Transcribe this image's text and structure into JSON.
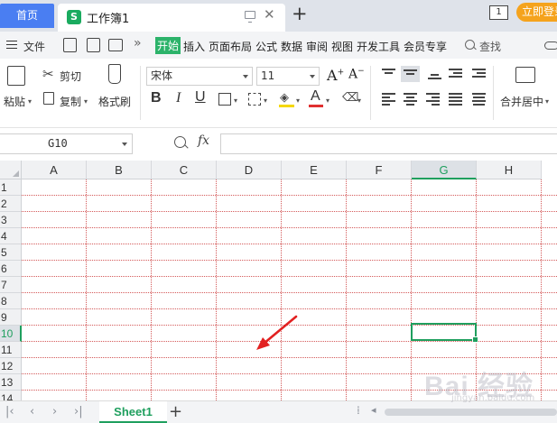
{
  "titlebar": {
    "home_tab": "首页",
    "doc_logo": "S",
    "doc_tab": "工作簿1",
    "page_badge": "1",
    "login_button": "立即登录"
  },
  "menubar": {
    "file": "文件",
    "tabs": [
      "开始",
      "插入",
      "页面布局",
      "公式",
      "数据",
      "审阅",
      "视图",
      "开发工具",
      "会员专享"
    ],
    "active_tab": "开始",
    "search": "查找"
  },
  "ribbon": {
    "paste": "粘贴",
    "cut": "剪切",
    "copy": "复制",
    "format_painter": "格式刷",
    "font_name": "宋体",
    "font_size": "11",
    "grow_font": "A",
    "shrink_font": "A",
    "bold": "B",
    "italic": "I",
    "underline": "U",
    "font_color_letter": "A",
    "merge_center": "合并居中",
    "font_color_hex": "#e03030",
    "fill_color_hex": "#f5d800"
  },
  "formula_bar": {
    "cell_ref": "G10",
    "fx": "fx",
    "formula": ""
  },
  "grid": {
    "columns": [
      "A",
      "B",
      "C",
      "D",
      "E",
      "F",
      "G",
      "H"
    ],
    "rows": [
      "1",
      "2",
      "3",
      "4",
      "5",
      "6",
      "7",
      "8",
      "9",
      "10",
      "11",
      "12",
      "13",
      "14"
    ],
    "selected_column": "G",
    "selected_row": "10",
    "gridline_color": "#d45a5a",
    "accent_color": "#1f9f5e"
  },
  "sheetbar": {
    "sheets": [
      "Sheet1"
    ],
    "active_sheet": "Sheet1"
  },
  "watermark": {
    "text": "Bai 经验",
    "sub": "jingyan.baidu.com"
  }
}
